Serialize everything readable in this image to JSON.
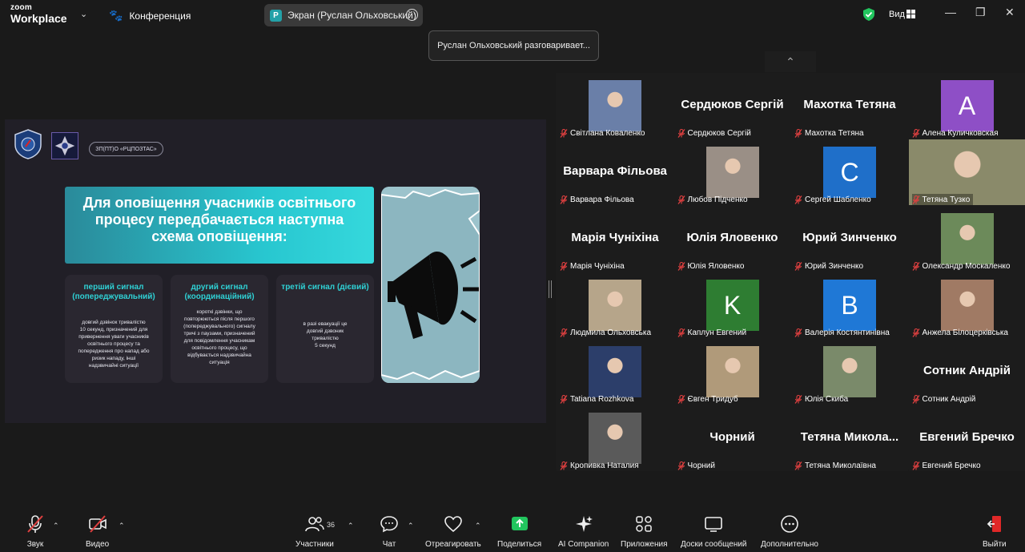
{
  "app": {
    "logo_top": "zoom",
    "logo_bottom": "Workplace"
  },
  "header": {
    "meeting_label": "Конференция",
    "screen_share_tab": "Экран (Руслан Ольховський)",
    "screen_share_initial": "P",
    "view_label": "Вид"
  },
  "notification": {
    "text": "Руслан Ольховський разговаривает..."
  },
  "slide": {
    "org_name": "ЗП(ПТ)О «РЦПОЗТАС»",
    "headline": "Для оповіщення учасників освітнього\nпроцесу передбачається наступна\nсхема оповіщення:",
    "cards": [
      {
        "title": "перший сигнал\n(попереджувальний)",
        "body": "довгий дзвінок тривалістю\n10 секунд, призначений для\nпривернення уваги учасників\nосвітнього процесу та\nпопередження про напад або\nризик нападу, інші\nнадзвичайні ситуації"
      },
      {
        "title": "другий сигнал\n(координаційний)",
        "body": "короткі дзвінки, що\nповторюються після першого\n(попереджувального) сигналу\nтричі з паузами, призначений\nдля повідомлення учасникам\nосвітнього процесу, що\nвідбувається надзвичайна\nситуація"
      },
      {
        "title": "третій сигнал (дієвий)",
        "body": "в разі евакуації це\nдовгий дзвоник\nтривалістю\n5 секунд"
      }
    ]
  },
  "participants": [
    {
      "name": "Світлана Коваленко",
      "display": "photo",
      "color": "#6a7fa8"
    },
    {
      "name": "Сердюков Сергій",
      "display": "name",
      "big": "Сердюков  Сергій"
    },
    {
      "name": "Махотка Тетяна",
      "display": "name",
      "big": "Махотка Тетяна"
    },
    {
      "name": "Алена Куличковская",
      "display": "letter",
      "letter": "A",
      "color": "#8e4fc6"
    },
    {
      "name": "Варвара Фільова",
      "display": "name",
      "big": "Варвара Фільова"
    },
    {
      "name": "Любов Підченко",
      "display": "photo",
      "color": "#9a8f86"
    },
    {
      "name": "Сергей Шабленко",
      "display": "letter",
      "letter": "C",
      "color": "#1f6fc9"
    },
    {
      "name": "Тетяна Тузко",
      "display": "talking",
      "color": "#8a8a6a"
    },
    {
      "name": "Марія Чуніхіна",
      "display": "name",
      "big": "Марія Чуніхіна"
    },
    {
      "name": "Юлія Яловенко",
      "display": "name",
      "big": "Юлія Яловенко"
    },
    {
      "name": "Юрий Зинченко",
      "display": "name",
      "big": "Юрий Зинченко"
    },
    {
      "name": "Олександр Москаленко",
      "display": "photo",
      "color": "#6c8a5a"
    },
    {
      "name": "Людмила Ольховська",
      "display": "photo",
      "color": "#b6a58a"
    },
    {
      "name": "Каплун Евгений",
      "display": "letter",
      "letter": "K",
      "color": "#2e7d32"
    },
    {
      "name": "Валерія Костянтинівна",
      "display": "letter",
      "letter": "B",
      "color": "#1f78d6"
    },
    {
      "name": "Анжела Білоцерківська",
      "display": "photo",
      "color": "#a07a64"
    },
    {
      "name": "Tatiana Rozhkova",
      "display": "photo",
      "color": "#2c3e6a"
    },
    {
      "name": "Євген Тридуб",
      "display": "photo",
      "color": "#b09a7a"
    },
    {
      "name": "Юлія Скиба",
      "display": "photo",
      "color": "#7a8a6a"
    },
    {
      "name": "Сотник Андрій",
      "display": "name",
      "big": "Сотник Андрій"
    },
    {
      "name": "Кропивка Наталия",
      "display": "photo",
      "color": "#5a5a5a"
    },
    {
      "name": "Чорний",
      "display": "name",
      "big": "Чорний"
    },
    {
      "name": "Тетяна Миколаївна",
      "display": "name",
      "big": "Тетяна  Микола..."
    },
    {
      "name": "Евгений Бречко",
      "display": "name",
      "big": "Евгений Бречко"
    }
  ],
  "toolbar": {
    "audio": "Звук",
    "video": "Видео",
    "participants": "Участники",
    "participants_count": "36",
    "chat": "Чат",
    "react": "Отреагировать",
    "share": "Поделиться",
    "ai": "AI Companion",
    "apps": "Приложения",
    "whiteboards": "Доски сообщений",
    "more": "Дополнительно",
    "leave": "Выйти"
  },
  "colors": {
    "accent_teal": "#2fd1d5",
    "muted_red": "#e04040",
    "share_green": "#22c55e",
    "leave_red": "#e02828"
  }
}
